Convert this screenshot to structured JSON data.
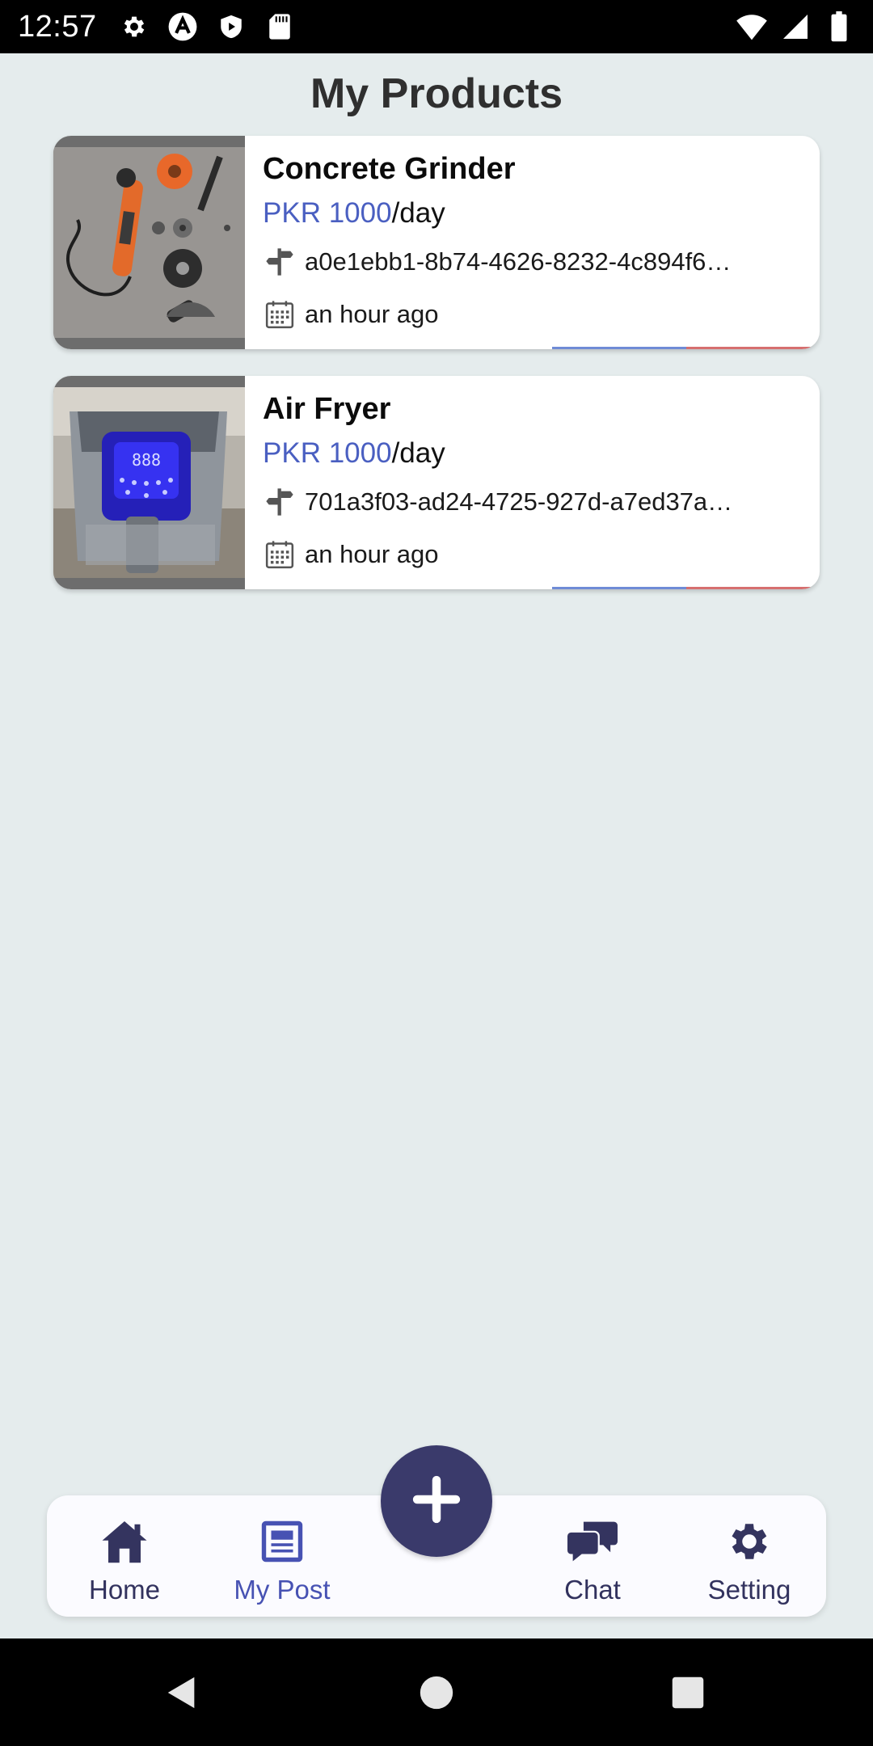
{
  "status_bar": {
    "time": "12:57",
    "icons_left": [
      "gear-icon",
      "a-badge-icon",
      "shield-play-icon",
      "sd-card-icon"
    ],
    "icons_right": [
      "wifi-icon",
      "signal-icon",
      "battery-icon"
    ]
  },
  "page": {
    "title": "My Products"
  },
  "products": [
    {
      "title": "Concrete Grinder",
      "price_amount": "PKR 1000",
      "price_unit": "/day",
      "location": "a0e1ebb1-8b74-4626-8232-4c894f6…",
      "time": "an hour ago"
    },
    {
      "title": "Air Fryer",
      "price_amount": "PKR 1000",
      "price_unit": "/day",
      "location": "701a3f03-ad24-4725-927d-a7ed37a…",
      "time": "an hour ago"
    }
  ],
  "bottom_nav": {
    "items": [
      {
        "label": "Home",
        "icon": "home-icon",
        "active": false
      },
      {
        "label": "My Post",
        "icon": "post-icon",
        "active": true
      },
      {
        "label": "Chat",
        "icon": "chat-icon",
        "active": false
      },
      {
        "label": "Setting",
        "icon": "gear-icon",
        "active": false
      }
    ],
    "fab_icon": "plus-icon"
  },
  "colors": {
    "background": "#e5eced",
    "accent": "#4a5fc1",
    "nav_dark": "#3a3a6b",
    "nav_active": "#4752b3"
  }
}
